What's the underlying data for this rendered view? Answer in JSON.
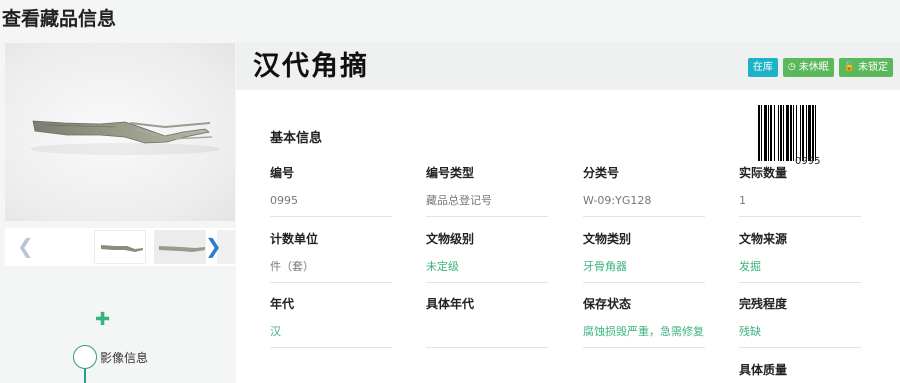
{
  "page": {
    "title": "查看藏品信息"
  },
  "item": {
    "name": "汉代角摘",
    "badges": [
      {
        "label": "在库",
        "color": "#1cb3c8",
        "icon": ""
      },
      {
        "label": "未休眠",
        "color": "#5cb85c",
        "icon": "clock-icon"
      },
      {
        "label": "未锁定",
        "color": "#5cb85c",
        "icon": "lock-icon"
      }
    ],
    "barcode_number": "0995"
  },
  "gallery": {
    "prev_icon": "chevron-left-icon",
    "next_icon": "chevron-right-icon"
  },
  "sidebar": {
    "add_icon": "plus-icon",
    "media_label": "影像信息"
  },
  "basic": {
    "section_title": "基本信息",
    "fields": [
      {
        "label": "编号",
        "value": "0995",
        "style": "plain"
      },
      {
        "label": "编号类型",
        "value": "藏品总登记号",
        "style": "plain"
      },
      {
        "label": "分类号",
        "value": "W-09:YG128",
        "style": "plain"
      },
      {
        "label": "实际数量",
        "value": "1",
        "style": "plain"
      },
      {
        "label": "计数单位",
        "value": "件（套）",
        "style": "plain"
      },
      {
        "label": "文物级别",
        "value": "未定级",
        "style": "link"
      },
      {
        "label": "文物类别",
        "value": "牙骨角器",
        "style": "link"
      },
      {
        "label": "文物来源",
        "value": "发掘",
        "style": "link"
      },
      {
        "label": "年代",
        "value": "汉",
        "style": "link"
      },
      {
        "label": "具体年代",
        "value": "",
        "style": "plain"
      },
      {
        "label": "保存状态",
        "value": "腐蚀损毁严重，急需修复",
        "style": "link"
      },
      {
        "label": "完残程度",
        "value": "残缺",
        "style": "link"
      },
      {
        "label": "具体质量",
        "value": "",
        "style": "plain"
      }
    ]
  }
}
